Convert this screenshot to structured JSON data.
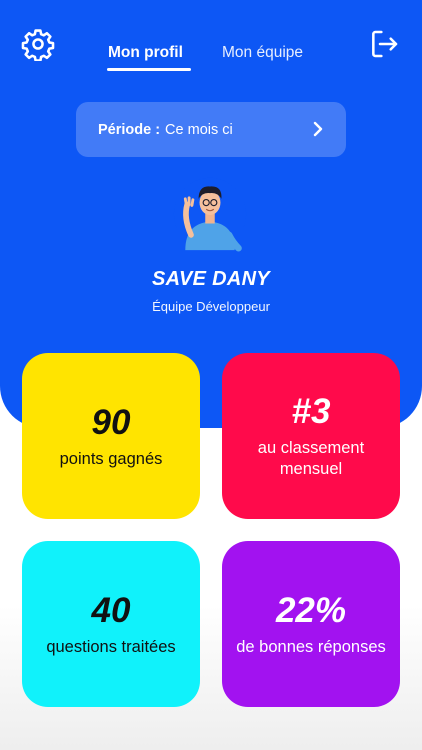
{
  "nav": {
    "tabs": [
      {
        "label": "Mon profil",
        "active": true
      },
      {
        "label": "Mon équipe",
        "active": false
      }
    ],
    "settings_icon": "gear-icon",
    "logout_icon": "logout-icon"
  },
  "period": {
    "label": "Période :",
    "value": "Ce mois ci"
  },
  "profile": {
    "name": "SAVE DANY",
    "team": "Équipe Développeur"
  },
  "stats": [
    {
      "value": "90",
      "label": "points gagnés",
      "color": "#ffe400"
    },
    {
      "value": "#3",
      "label": "au classement mensuel",
      "color": "#ff0a4b"
    },
    {
      "value": "40",
      "label": "questions traitées",
      "color": "#10f2fb"
    },
    {
      "value": "22%",
      "label": "de bonnes réponses",
      "color": "#a212f0"
    }
  ],
  "colors": {
    "header": "#0d57f5"
  }
}
